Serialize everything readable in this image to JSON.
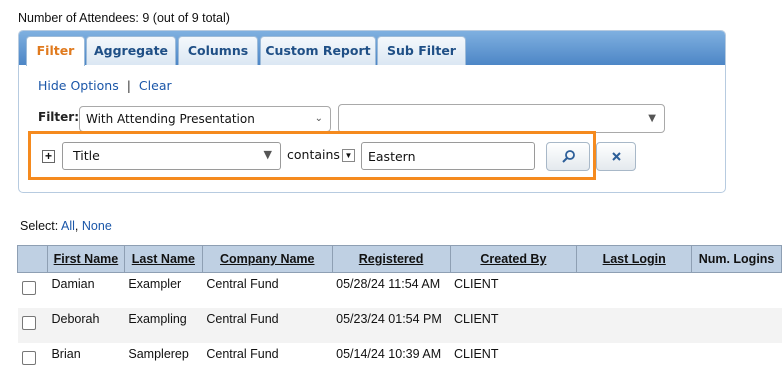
{
  "summary": "Number of Attendees: 9 (out of 9 total)",
  "tabs": [
    "Filter",
    "Aggregate",
    "Columns",
    "Custom Report",
    "Sub Filter"
  ],
  "options": {
    "hide_label": "Hide Options",
    "separator": "|",
    "clear_label": "Clear"
  },
  "filter": {
    "label": "Filter:",
    "primary_value": "With Attending Presentation",
    "secondary_value": "",
    "field_value": "Title",
    "operator": "contains",
    "text_value": "Eastern"
  },
  "selection": {
    "prefix": "Select:",
    "all": "All",
    "comma": ",",
    "none": "None"
  },
  "table": {
    "headers": [
      "First Name",
      "Last Name",
      "Company Name",
      "Registered",
      "Created By",
      "Last Login",
      "Num. Logins"
    ],
    "rows": [
      [
        "Damian",
        "Exampler",
        "Central Fund",
        "05/28/24 11:54 AM",
        "CLIENT",
        "",
        ""
      ],
      [
        "Deborah",
        "Exampling",
        "Central Fund",
        "05/23/24 01:54 PM",
        "CLIENT",
        "",
        ""
      ],
      [
        "Brian",
        "Samplerep",
        "Central Fund",
        "05/14/24 10:39 AM",
        "CLIENT",
        "",
        ""
      ]
    ]
  },
  "colors": {
    "highlight": "#f58a1e",
    "active_tab": "#e07a1e",
    "link": "#1a56a8",
    "header_bg": "#bfd0e3"
  },
  "icons": {
    "search": "search-icon",
    "remove": "close-icon",
    "add": "plus-icon"
  }
}
